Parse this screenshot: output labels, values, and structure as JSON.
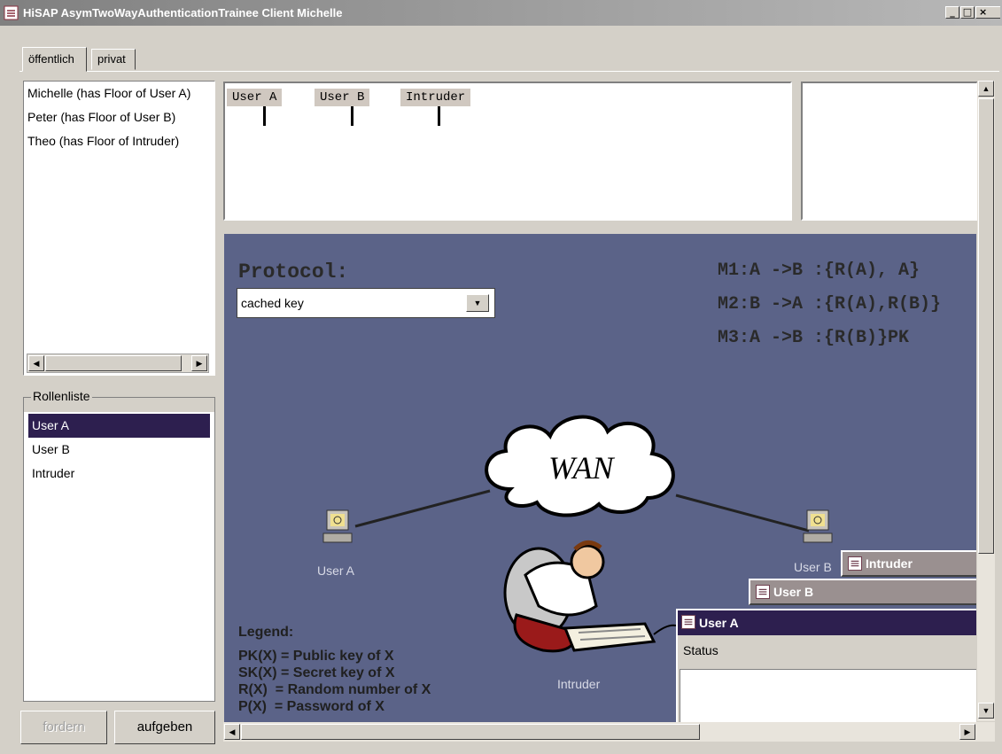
{
  "window": {
    "title": "HiSAP AsymTwoWayAuthenticationTrainee Client Michelle"
  },
  "tabs": [
    {
      "label": "öffentlich"
    },
    {
      "label": "privat"
    }
  ],
  "users_list": [
    "Michelle (has Floor of User A)",
    "Peter (has Floor of User B)",
    "Theo (has Floor of Intruder)"
  ],
  "roles": {
    "title": "Rollenliste",
    "items": [
      "User A",
      "User B",
      "Intruder"
    ],
    "selected": "User A"
  },
  "buttons": {
    "fordern": "fordern",
    "aufgeben": "aufgeben"
  },
  "sequence_lanes": [
    "User A",
    "User B",
    "Intruder"
  ],
  "protocol": {
    "label": "Protocol:",
    "selected": "cached key"
  },
  "messages": [
    "M1:A ->B :{R(A), A}",
    "M2:B ->A :{R(A),R(B)}",
    "M3:A ->B :{R(B)}PK"
  ],
  "network": {
    "cloud_label": "WAN",
    "node_a": "User A",
    "node_b": "User B",
    "intruder": "Intruder"
  },
  "legend": {
    "title": "Legend:",
    "lines": [
      "PK(X) = Public key of X",
      "SK(X) = Secret key of X",
      "R(X)  = Random number of X",
      "P(X)  = Password of X"
    ]
  },
  "frames": {
    "intruder": "Intruder",
    "user_b": "User B",
    "user_a": "User A",
    "status_label": "Status"
  },
  "icons": [
    "app-icon",
    "minimize-icon",
    "maximize-icon",
    "close-icon",
    "computer-icon",
    "hacker-figure",
    "cloud-icon",
    "dropdown-arrow-icon"
  ]
}
